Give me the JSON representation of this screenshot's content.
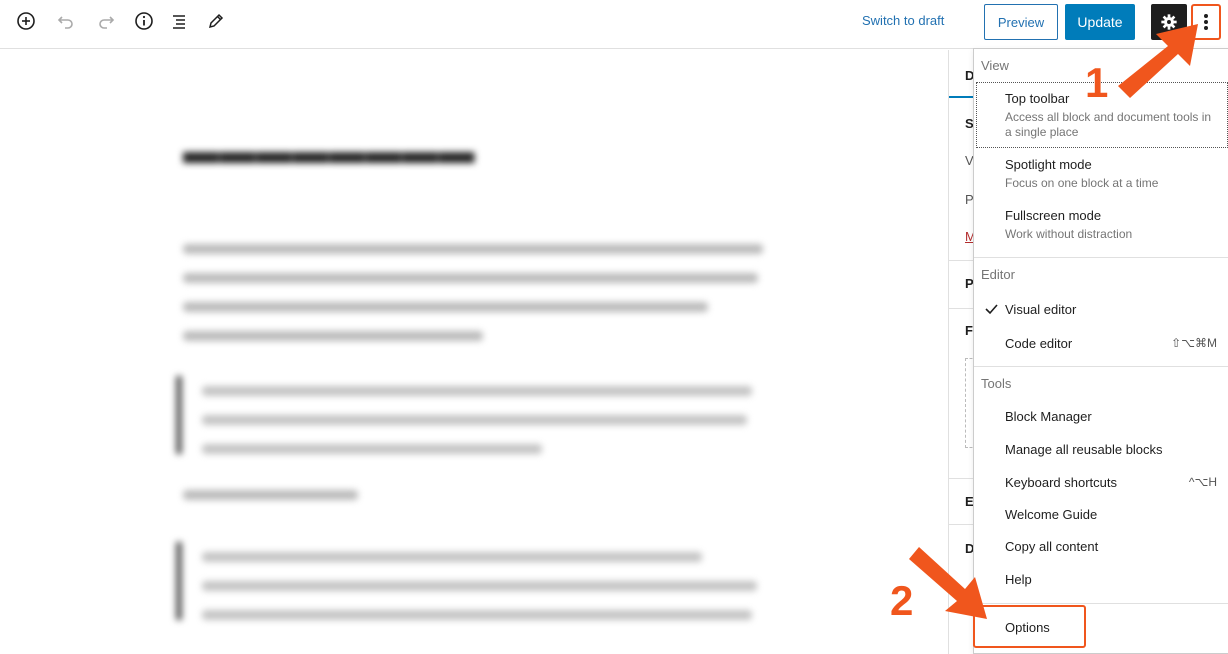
{
  "toolbar": {
    "add_block_icon": "plus-circle-icon",
    "undo_icon": "undo-icon",
    "redo_icon": "redo-icon",
    "details_icon": "info-icon",
    "outline_icon": "list-view-icon",
    "tools_icon": "pencil-icon",
    "switch_to_draft": "Switch to draft",
    "preview": "Preview",
    "update": "Update",
    "settings_icon": "gear-icon",
    "more_icon": "vertical-ellipsis-icon"
  },
  "menu": {
    "view_label": "View",
    "view_items": [
      {
        "title": "Top toolbar",
        "desc": "Access all block and document tools in a single place"
      },
      {
        "title": "Spotlight mode",
        "desc": "Focus on one block at a time"
      },
      {
        "title": "Fullscreen mode",
        "desc": "Work without distraction"
      }
    ],
    "editor_label": "Editor",
    "editor_items": [
      {
        "title": "Visual editor",
        "shortcut": "",
        "checked": true
      },
      {
        "title": "Code editor",
        "shortcut": "⇧⌥⌘M",
        "checked": false
      }
    ],
    "tools_label": "Tools",
    "tools_items": [
      {
        "title": "Block Manager",
        "shortcut": ""
      },
      {
        "title": "Manage all reusable blocks",
        "shortcut": ""
      },
      {
        "title": "Keyboard shortcuts",
        "shortcut": "^⌥H"
      },
      {
        "title": "Welcome Guide",
        "shortcut": ""
      },
      {
        "title": "Copy all content",
        "shortcut": ""
      },
      {
        "title": "Help",
        "shortcut": ""
      }
    ],
    "options": "Options"
  },
  "sidebar": {
    "letters": [
      "D",
      "S",
      "V",
      "P",
      "M",
      "P",
      "F",
      "E",
      "D"
    ]
  },
  "annotations": {
    "step1": "1",
    "step2": "2",
    "color": "#f0561d"
  },
  "colors": {
    "accent": "#007cba",
    "link": "#2271b1",
    "annotation": "#f0561d"
  }
}
